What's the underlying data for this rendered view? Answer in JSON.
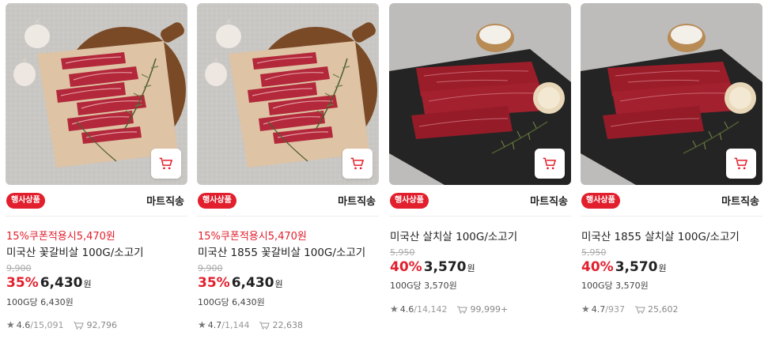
{
  "colors": {
    "accent": "#e21f2d",
    "text": "#222222",
    "muted": "#888888"
  },
  "products": [
    {
      "image": "beef-flap-on-cutting-board",
      "badge": "행사상품",
      "delivery": "마트직송",
      "coupon": "15%쿠폰적용시5,470원",
      "title": "미국산 꽃갈비살 100G/소고기",
      "original_price": "9,900",
      "discount_rate": "35%",
      "price": "6,430",
      "won": "원",
      "unit_price": "100G당 6,430원",
      "rating": "4.6",
      "review_count": "/15,091",
      "purchase_count": "92,796"
    },
    {
      "image": "beef-flap-on-cutting-board",
      "badge": "행사상품",
      "delivery": "마트직송",
      "coupon": "15%쿠폰적용시5,470원",
      "title": "미국산 1855 꽃갈비살 100G/소고기",
      "original_price": "9,900",
      "discount_rate": "35%",
      "price": "6,430",
      "won": "원",
      "unit_price": "100G당 6,430원",
      "rating": "4.7",
      "review_count": "/1,144",
      "purchase_count": "22,638"
    },
    {
      "image": "chuck-flap-on-slate",
      "badge": "행사상품",
      "delivery": "마트직송",
      "coupon": "",
      "title": "미국산 살치살 100G/소고기",
      "original_price": "5,950",
      "discount_rate": "40%",
      "price": "3,570",
      "won": "원",
      "unit_price": "100G당 3,570원",
      "rating": "4.6",
      "review_count": "/14,142",
      "purchase_count": "99,999+"
    },
    {
      "image": "chuck-flap-on-slate",
      "badge": "행사상품",
      "delivery": "마트직송",
      "coupon": "",
      "title": "미국산 1855 살치살 100G/소고기",
      "original_price": "5,950",
      "discount_rate": "40%",
      "price": "3,570",
      "won": "원",
      "unit_price": "100G당 3,570원",
      "rating": "4.7",
      "review_count": "/937",
      "purchase_count": "25,602"
    }
  ]
}
